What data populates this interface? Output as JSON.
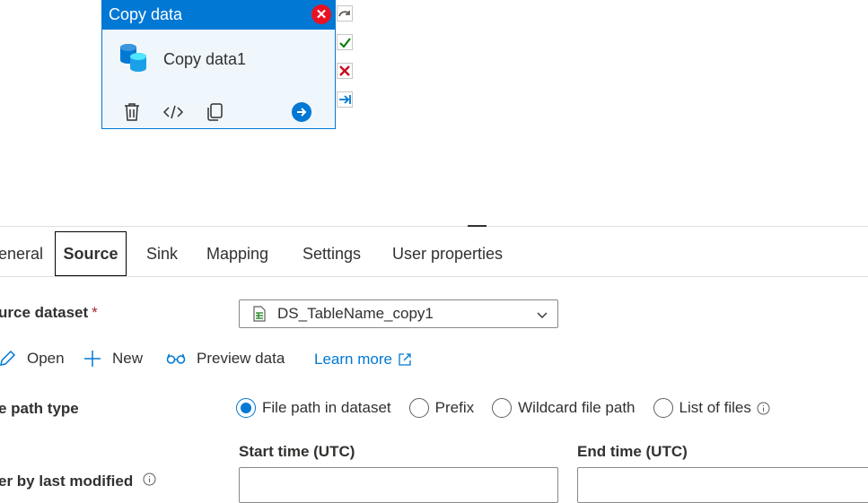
{
  "activity": {
    "type_title": "Copy data",
    "name": "Copy data1",
    "close_icon": "error-close-icon",
    "tools": [
      "delete-icon",
      "code-icon",
      "clone-icon",
      "go-arrow-icon"
    ],
    "ports": [
      "completion-icon",
      "success-check-icon",
      "failure-x-icon",
      "skip-arrow-icon"
    ]
  },
  "tabs": [
    "eneral",
    "Source",
    "Sink",
    "Mapping",
    "Settings",
    "User properties"
  ],
  "active_tab": "Source",
  "source": {
    "dataset_label": "urce dataset",
    "required_mark": "*",
    "dataset_value": "DS_TableName_copy1",
    "actions": {
      "open": "Open",
      "new": "New",
      "preview": "Preview data",
      "learn_more": "Learn more"
    },
    "path_type_label": "e path type",
    "path_options": [
      "File path in dataset",
      "Prefix",
      "Wildcard file path",
      "List of files"
    ],
    "selected_path_option": "File path in dataset",
    "filter_label": "er by last modified",
    "start_time_label": "Start time (UTC)",
    "end_time_label": "End time (UTC)",
    "start_time_value": "",
    "end_time_value": ""
  },
  "colors": {
    "accent": "#0078d4",
    "error": "#e81123",
    "success": "#107c10",
    "required": "#a4262c"
  }
}
